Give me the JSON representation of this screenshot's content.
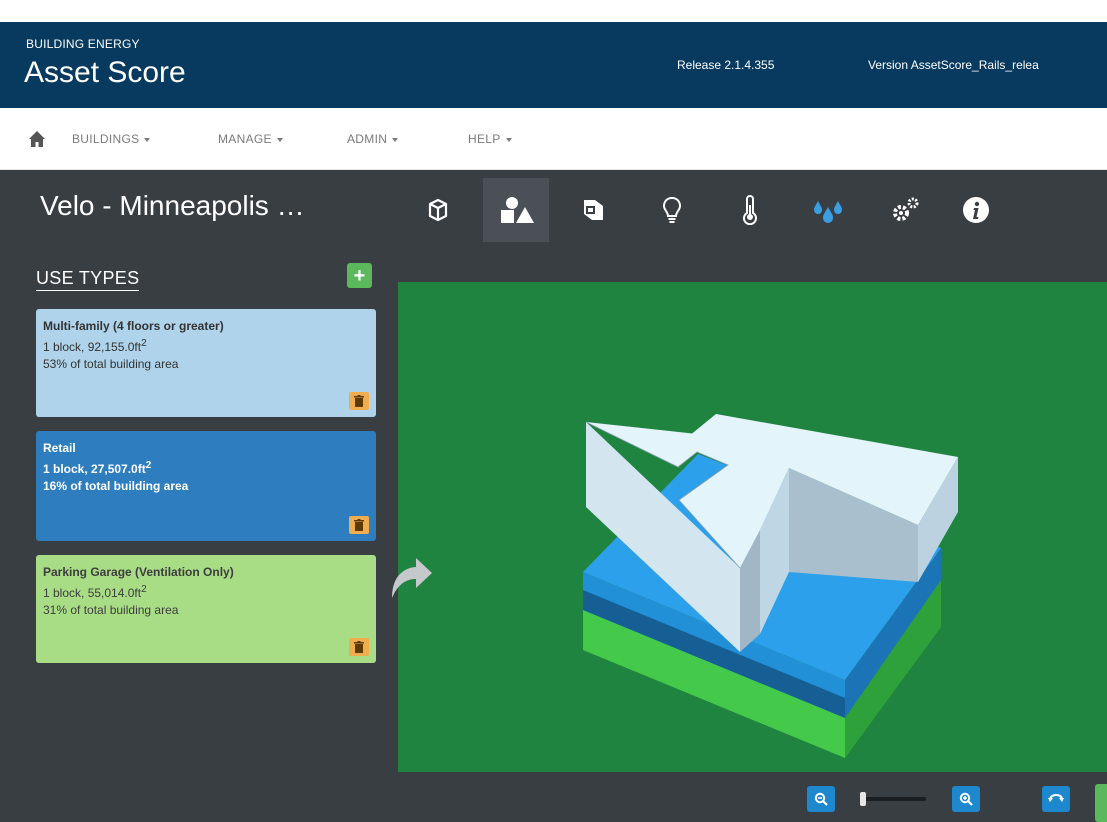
{
  "header": {
    "brand_top": "BUILDING ENERGY",
    "brand_main": "Asset Score",
    "release": "Release 2.1.4.355",
    "version": "Version AssetScore_Rails_relea"
  },
  "nav": {
    "items": [
      {
        "label": "BUILDINGS"
      },
      {
        "label": "MANAGE"
      },
      {
        "label": "ADMIN"
      },
      {
        "label": "HELP"
      }
    ]
  },
  "toolbar": {
    "building_name": "Velo - Minneapolis …",
    "icons": [
      "cube-icon",
      "shapes-icon",
      "envelope-icon",
      "lightbulb-icon",
      "thermometer-icon",
      "water-drops-icon",
      "gears-icon",
      "info-icon"
    ],
    "active_icon": "shapes-icon"
  },
  "sidebar": {
    "heading": "USE TYPES",
    "add_label": "+",
    "use_types": [
      {
        "name": "Multi-family (4 floors or greater)",
        "blocks": "1 block, 92,155.0ft",
        "sup": "2",
        "share": "53% of total building area"
      },
      {
        "name": "Retail",
        "blocks": "1 block, 27,507.0ft",
        "sup": "2",
        "share": "16% of total building area"
      },
      {
        "name": "Parking Garage (Ventilation Only)",
        "blocks": "1 block, 55,014.0ft",
        "sup": "2",
        "share": "31% of total building area"
      }
    ]
  },
  "colors": {
    "header_bg": "#073a5e",
    "panel_bg": "#393e43",
    "canvas_bg": "#1f8440",
    "multifamily": "#aed3ea",
    "retail": "#2e7dbf",
    "parking": "#a8dd86",
    "trash": "#f0ad4e",
    "add": "#5cb85c",
    "zoom": "#1e88cf"
  }
}
